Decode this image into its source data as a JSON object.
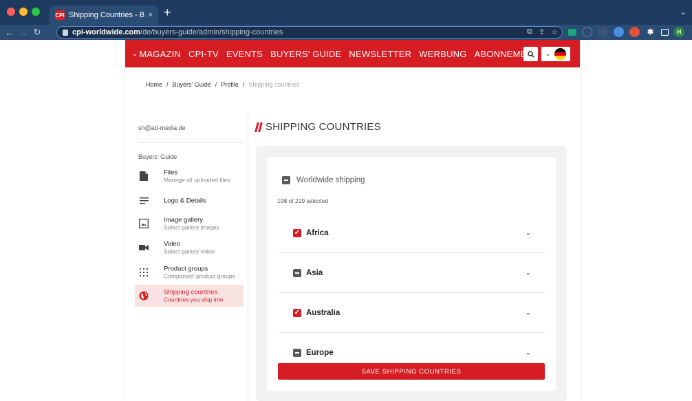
{
  "browser": {
    "tab_title": "Shipping Countries - Buyers G",
    "tab_close": "×",
    "new_tab": "+",
    "tab_menu": "⌄",
    "url_host": "cpi-worldwide.com",
    "url_path": "/de/buyers-guide/admin/shipping-countries",
    "profile_initial": "H"
  },
  "nav": {
    "magazin": "MAGAZIN",
    "items": [
      "CPI-TV",
      "EVENTS",
      "BUYERS' GUIDE",
      "NEWSLETTER",
      "WERBUNG",
      "ABONNEMENT"
    ]
  },
  "breadcrumb": {
    "items": [
      "Home",
      "Buyers' Guide",
      "Profile"
    ],
    "current": "Shipping countries",
    "separator": "/"
  },
  "sidebar": {
    "email": "sh@ad-media.de",
    "heading": "Buyers' Guide",
    "items": [
      {
        "title": "Files",
        "sub": "Manage all uploaded files"
      },
      {
        "title": "Logo & Details",
        "sub": ""
      },
      {
        "title": "Image gallery",
        "sub": "Select gallery images"
      },
      {
        "title": "Video",
        "sub": "Select gallery video"
      },
      {
        "title": "Product groups",
        "sub": "Companies' product groups"
      },
      {
        "title": "Shipping countries",
        "sub": "Countries you ship into"
      }
    ],
    "active_index": 5
  },
  "main": {
    "title": "SHIPPING COUNTRIES",
    "worldwide_label": "Worldwide shipping",
    "selected_count": "198 of 219 selected",
    "regions": [
      {
        "name": "Africa",
        "state": "checked"
      },
      {
        "name": "Asia",
        "state": "indeterminate"
      },
      {
        "name": "Australia",
        "state": "checked"
      },
      {
        "name": "Europe",
        "state": "indeterminate"
      }
    ],
    "save_label": "SAVE SHIPPING COUNTRIES"
  },
  "colors": {
    "brand_red": "#d61d23",
    "active_bg": "#f9e3e2",
    "chrome_dark": "#1f3a5f"
  }
}
